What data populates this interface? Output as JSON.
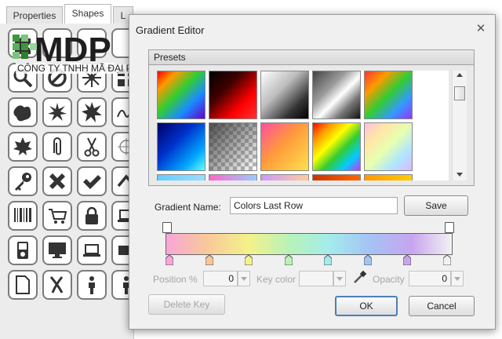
{
  "back_panel": {
    "tabs": [
      "Properties",
      "Shapes",
      "L"
    ],
    "active_tab": "Shapes",
    "shape_icons": [
      "puzzle-icon",
      "blank",
      "blank",
      "blank",
      "magnifier-icon",
      "no-sign-icon",
      "sunburst-icon",
      "grid-icon",
      "splat-icon",
      "starburst-icon",
      "explosion-icon",
      "scribble-icon",
      "maple-leaf-icon",
      "paperclip-icon",
      "scissors-icon",
      "crosshair-icon",
      "key-icon",
      "x-mark-icon",
      "checkmark-icon",
      "chevron-icon",
      "barcode-icon",
      "shopping-cart-icon",
      "padlock-icon",
      "laptop-icon",
      "mp3-player-icon",
      "monitor-icon",
      "laptop-icon",
      "camera-icon",
      "document-icon",
      "scribble-x-icon",
      "person-icon",
      "person-icon"
    ]
  },
  "watermark": {
    "logo_text": "MDP",
    "caption": "CÔNG TY TNHH MÃ ĐẠI PHÚC"
  },
  "dialog": {
    "title": "Gradient Editor",
    "close_glyph": "✕",
    "presets_label": "Presets",
    "gradient_name_label": "Gradient Name:",
    "gradient_name_value": "Colors Last Row",
    "save_label": "Save",
    "position_label": "Position %",
    "position_value": "0",
    "key_color_label": "Key color",
    "opacity_label": "Opacity",
    "opacity_value": "0",
    "delete_key_label": "Delete Key",
    "ok_label": "OK",
    "cancel_label": "Cancel",
    "gradient_stops": [
      "#f8a6d8",
      "#f8c89a",
      "#f4f28a",
      "#b8f2b8",
      "#a4ecec",
      "#a4c4f4",
      "#c8a4f0",
      "#f2f2f2"
    ]
  }
}
